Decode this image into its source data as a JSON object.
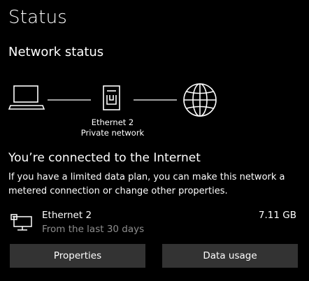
{
  "page": {
    "title": "Status"
  },
  "network_status": {
    "heading": "Network status",
    "diagram": {
      "device_icon": "laptop-icon",
      "adapter_icon": "ethernet-port-icon",
      "internet_icon": "globe-icon",
      "adapter_name": "Ethernet 2",
      "network_type": "Private network"
    }
  },
  "connection": {
    "title": "You’re connected to the Internet",
    "description": "If you have a limited data plan, you can make this network a metered connection or change other properties."
  },
  "usage": {
    "icon": "network-computer-icon",
    "adapter_name": "Ethernet 2",
    "period": "From the last 30 days",
    "amount": "7.11 GB"
  },
  "buttons": {
    "properties": "Properties",
    "data_usage": "Data usage"
  },
  "colors": {
    "background": "#000000",
    "foreground": "#ffffff",
    "secondary_text": "#8e8e8e",
    "button_background": "#333333"
  }
}
